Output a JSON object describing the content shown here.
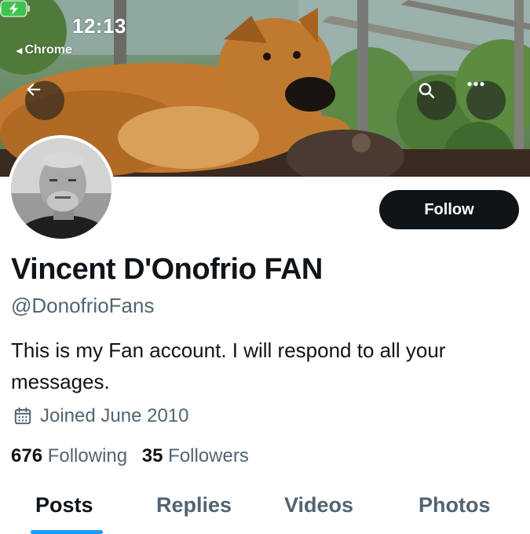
{
  "status_bar": {
    "time": "12:13",
    "back_app": "Chrome"
  },
  "header": {
    "back_icon": "arrow-left-icon",
    "search_icon": "search-icon",
    "more_icon": "more-horizontal-icon"
  },
  "profile": {
    "display_name": "Vincent D'Onofrio FAN",
    "handle": "@DonofrioFans",
    "bio": "This is my Fan account. I will respond to all your messages.",
    "joined": "Joined June 2010",
    "following_count": "676",
    "following_label": "Following",
    "followers_count": "35",
    "followers_label": "Followers",
    "follow_label": "Follow"
  },
  "tabs": [
    {
      "label": "Posts",
      "active": true
    },
    {
      "label": "Replies",
      "active": false
    },
    {
      "label": "Videos",
      "active": false
    },
    {
      "label": "Photos",
      "active": false
    }
  ],
  "colors": {
    "text_primary": "#0f1419",
    "text_secondary": "#536471",
    "accent": "#1d9bf0",
    "follow_button_bg": "#0f1419"
  }
}
